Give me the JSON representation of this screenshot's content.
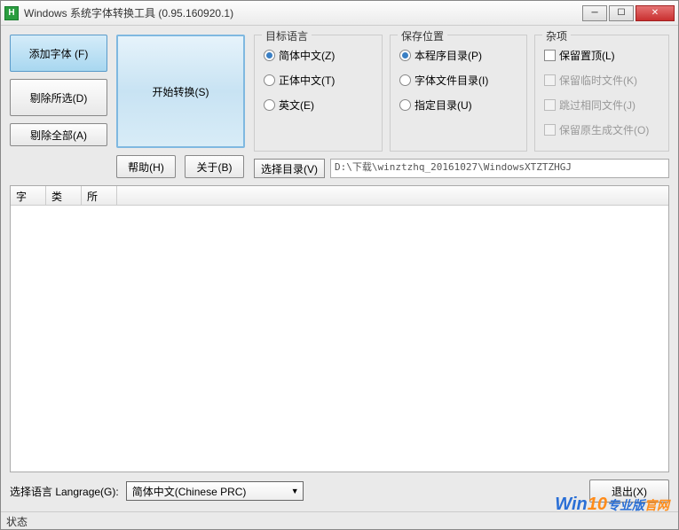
{
  "window": {
    "title": "Windows 系统字体转换工具 (0.95.160920.1)",
    "app_icon_letter": "H"
  },
  "left_buttons": {
    "add_font": "添加字体 (F)",
    "remove_sel": "剔除所选(D)",
    "remove_all": "剔除全部(A)"
  },
  "start_convert": "开始转换(S)",
  "row2": {
    "help": "帮助(H)",
    "about": "关于(B)",
    "select_dir": "选择目录(V)",
    "path": "D:\\下载\\winztzhq_20161027\\WindowsXTZTZHGJ"
  },
  "groups": {
    "target": {
      "title": "目标语言",
      "opts": [
        "简体中文(Z)",
        "正体中文(T)",
        "英文(E)"
      ],
      "selected": 0
    },
    "save": {
      "title": "保存位置",
      "opts": [
        "本程序目录(P)",
        "字体文件目录(I)",
        "指定目录(U)"
      ],
      "selected": 0
    },
    "misc": {
      "title": "杂项",
      "opts": [
        "保留置顶(L)",
        "保留临时文件(K)",
        "跳过相同文件(J)",
        "保留原生成文件(O)"
      ]
    }
  },
  "list": {
    "cols": [
      "字",
      "类",
      "所"
    ]
  },
  "bottom": {
    "lang_label": "选择语言 Langrage(G):",
    "lang_value": "简体中文(Chinese PRC)",
    "exit": "退出(X)"
  },
  "statusbar": "状态",
  "watermark": {
    "a": "Win",
    "b": "10",
    "c": "专业版",
    "d": "官网"
  }
}
